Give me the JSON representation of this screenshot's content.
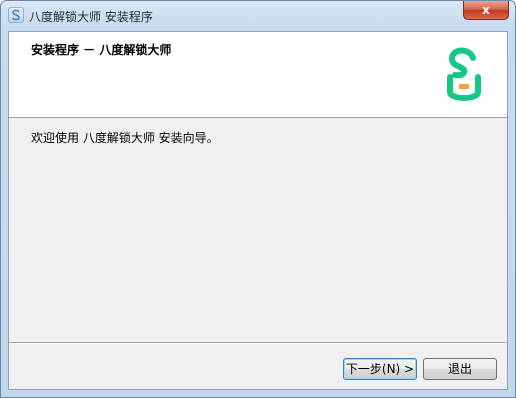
{
  "window": {
    "title": "八度解锁大师 安装程序",
    "close_label": "x",
    "app_icon": "app-s-icon"
  },
  "header": {
    "title": "安装程序 － 八度解锁大师",
    "logo_icon": "green-s-lock-logo",
    "logo_colors": [
      "#17c785",
      "#f2a33a"
    ]
  },
  "body": {
    "welcome_text": "欢迎使用 八度解锁大师 安装向导。"
  },
  "buttons": {
    "next_label": "下一步(N) >",
    "exit_label": "退出"
  }
}
